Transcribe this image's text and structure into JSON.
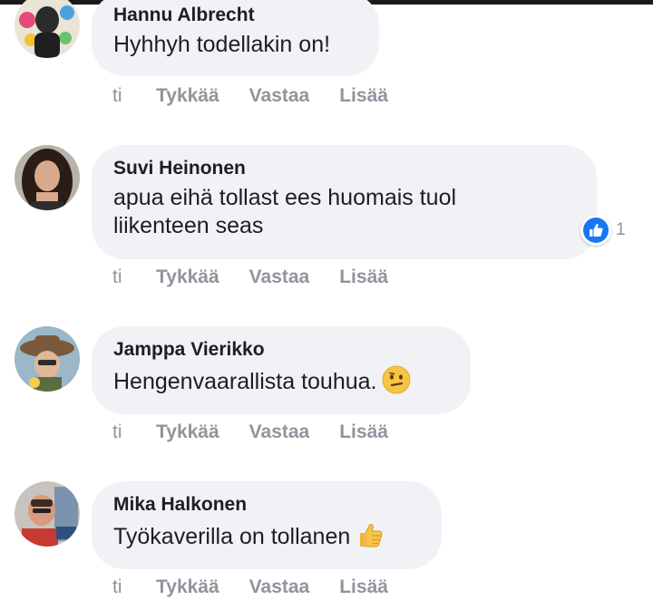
{
  "comments": [
    {
      "author": "Hannu Albrecht",
      "text": "Hyhhyh todellakin on!",
      "time": "ti",
      "like_label": "Tykkää",
      "reply_label": "Vastaa",
      "more_label": "Lisää"
    },
    {
      "author": "Suvi Heinonen",
      "text_line1": "apua eihä tollast ees huomais tuol",
      "text_line2": "liikenteen seas",
      "time": "ti",
      "like_label": "Tykkää",
      "reply_label": "Vastaa",
      "more_label": "Lisää",
      "reaction_count": "1",
      "reaction_icon": "like-icon"
    },
    {
      "author": "Jamppa Vierikko",
      "text": "Hengenvaarallista touhua.",
      "emoji": "confused-face-emoji",
      "time": "ti",
      "like_label": "Tykkää",
      "reply_label": "Vastaa",
      "more_label": "Lisää"
    },
    {
      "author": "Mika Halkonen",
      "text": "Työkaverilla on tollanen",
      "emoji": "thumbs-up-emoji",
      "time": "ti",
      "like_label": "Tykkää",
      "reply_label": "Vastaa",
      "more_label": "Lisää"
    }
  ],
  "colors": {
    "bubble": "#f0f2f5",
    "action_text": "#90949c",
    "like_blue": "#1877f2"
  }
}
